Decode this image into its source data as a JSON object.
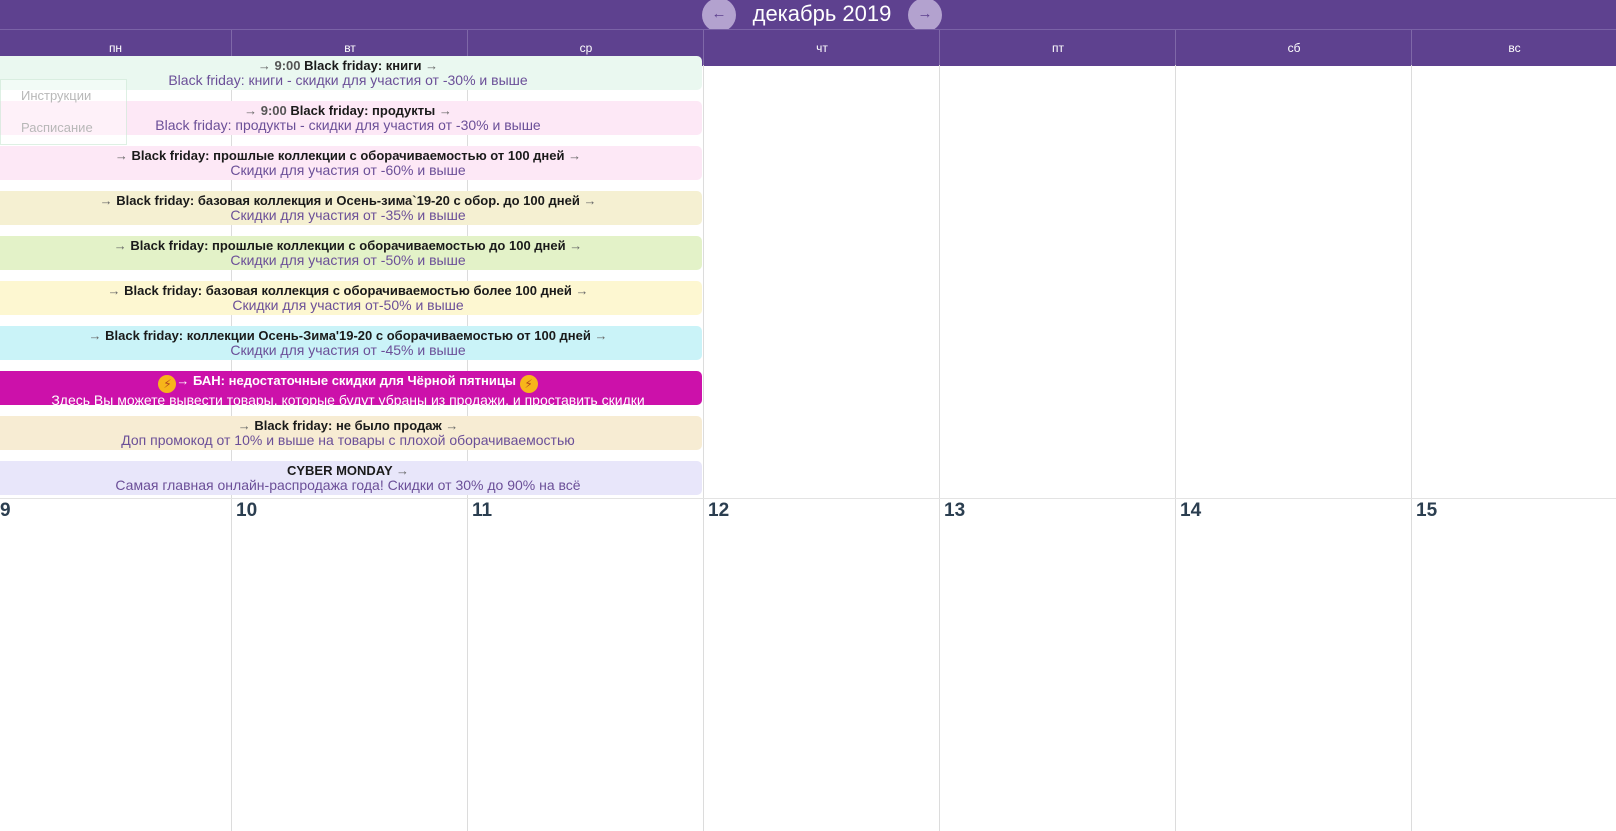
{
  "header": {
    "month_title": "декабрь 2019",
    "prev_label": "←",
    "next_label": "→",
    "colors": {
      "bar": "#5e418f",
      "nav_button": "#b3a2cf"
    }
  },
  "weekdays": [
    "пн",
    "вт",
    "ср",
    "чт",
    "пт",
    "сб",
    "вс"
  ],
  "week2_days": [
    "9",
    "10",
    "11",
    "12",
    "13",
    "14",
    "15"
  ],
  "side_menu": {
    "items": [
      {
        "label": "Инструкции"
      },
      {
        "label": "Расписание"
      }
    ]
  },
  "events": [
    {
      "arrow_left": "→",
      "time": "9:00",
      "title": "Black friday: книги",
      "arrow_right": "→",
      "subtitle": "Black friday: книги - скидки для участия от -30% и выше",
      "color": "#eaf8f0"
    },
    {
      "arrow_left": "→",
      "time": "9:00",
      "title": "Black friday: продукты",
      "arrow_right": "→",
      "subtitle": "Black friday: продукты - скидки для участия от -30% и выше",
      "color": "#fde8f6"
    },
    {
      "arrow_left": "→",
      "time": "",
      "title": "Black friday: прошлые коллекции с оборачиваемостью от 100 дней",
      "arrow_right": "→",
      "subtitle": "Скидки для участия от -60% и выше",
      "color": "#fde8f6"
    },
    {
      "arrow_left": "→",
      "time": "",
      "title": "Black friday: базовая коллекция и Осень-зима`19-20 с обор. до 100 дней",
      "arrow_right": "→",
      "subtitle": "Скидки для участия от -35% и выше",
      "color": "#f5f0d2"
    },
    {
      "arrow_left": "→",
      "time": "",
      "title": "Black friday: прошлые коллекции с оборачиваемостью до 100 дней",
      "arrow_right": "→",
      "subtitle": "Скидки для участия от -50% и выше",
      "color": "#e3f2c8"
    },
    {
      "arrow_left": "→",
      "time": "",
      "title": "Black friday: базовая коллекция с оборачиваемостью более 100 дней",
      "arrow_right": "→",
      "subtitle": "Скидки для участия от-50% и выше",
      "color": "#fdf7d1"
    },
    {
      "arrow_left": "→",
      "time": "",
      "title": "Black friday: коллекции Осень-Зима'19-20 с оборачиваемостью от 100 дней",
      "arrow_right": "→",
      "subtitle": "Скидки для участия от -45% и выше",
      "color": "#caf3f8"
    },
    {
      "arrow_left": "→",
      "time": "",
      "title": "БАН: недостаточные скидки для Чёрной пятницы",
      "arrow_right": "",
      "subtitle": "Здесь Вы можете вывести товары, которые будут убраны из продажи, и проставить скидки",
      "color": "#cc11aa",
      "ban": true
    },
    {
      "arrow_left": "→",
      "time": "",
      "title": "Black friday: не было продаж",
      "arrow_right": "→",
      "subtitle": "Доп промокод от 10% и выше на товары с плохой оборачиваемостью",
      "color": "#f7ecd3"
    },
    {
      "arrow_left": "",
      "time": "",
      "title": "CYBER MONDAY",
      "arrow_right": "→",
      "subtitle": "Самая главная онлайн-распродажа года! Скидки от 30% до 90% на всё",
      "color": "#e8e6fa"
    }
  ]
}
